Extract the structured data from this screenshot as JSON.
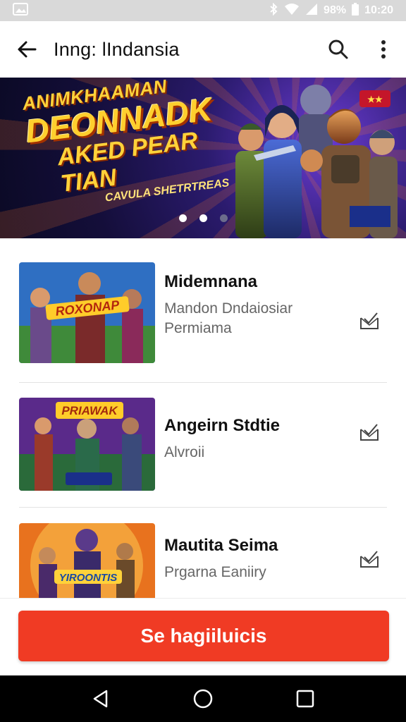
{
  "status_bar": {
    "battery_text": "98%",
    "time": "10:20"
  },
  "app_bar": {
    "title": "Inng: lIndansia",
    "icons": {
      "back": "arrow-back-icon",
      "search": "search-icon",
      "more": "more-vert-icon"
    }
  },
  "banner": {
    "line1": "ANIMKHAAMAN",
    "line2": "DEONNADK",
    "line3": "AKED PEAR TIAN",
    "line4": "CAVULA SHETRTREAS",
    "page_indicator": {
      "count": 3,
      "active_index": 1
    }
  },
  "list": {
    "items": [
      {
        "title": "Midemnana",
        "subtitle_line1": "Mandon Dndaiosiar",
        "subtitle_line2": "Permiama",
        "thumb_caption": "ROXONAP",
        "action_icon": "download-check-icon"
      },
      {
        "title": "Angeirn Stdtie",
        "subtitle_line1": "Alvroii",
        "subtitle_line2": "",
        "thumb_caption": "PRIAWAK",
        "action_icon": "download-check-icon"
      },
      {
        "title": "Mautita Seima",
        "subtitle_line1": "Prgarna Eaniiry",
        "subtitle_line2": "",
        "thumb_caption": "YIROONTIS",
        "action_icon": "download-check-icon"
      }
    ]
  },
  "cta": {
    "label": "Se hagiiluicis",
    "color": "#f03b24"
  },
  "nav_bar": {
    "icons": [
      "nav-back-icon",
      "nav-home-icon",
      "nav-recents-icon"
    ]
  }
}
